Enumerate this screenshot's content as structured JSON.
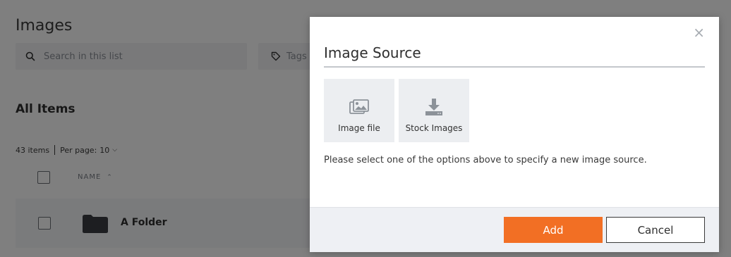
{
  "page": {
    "title": "Images",
    "search": {
      "placeholder": "Search in this list"
    },
    "tags_label": "Tags",
    "section_title": "All Items",
    "count_label": "43 items",
    "per_page_label": "Per page:",
    "per_page_value": "10",
    "column_name": "NAME",
    "rows": [
      {
        "name": "A Folder",
        "type": "folder"
      }
    ]
  },
  "modal": {
    "title": "Image Source",
    "close_icon": "close-icon",
    "options": [
      {
        "label": "Image file",
        "icon": "image-gallery-icon"
      },
      {
        "label": "Stock Images",
        "icon": "download-icon"
      }
    ],
    "help_text": "Please select one of the options above to specify a new image source.",
    "add_label": "Add",
    "cancel_label": "Cancel"
  },
  "colors": {
    "accent": "#f26f24",
    "overlay": "rgba(0,0,0,0.5)",
    "tile_bg": "#eceef1",
    "footer_bg": "#eef0f4"
  }
}
